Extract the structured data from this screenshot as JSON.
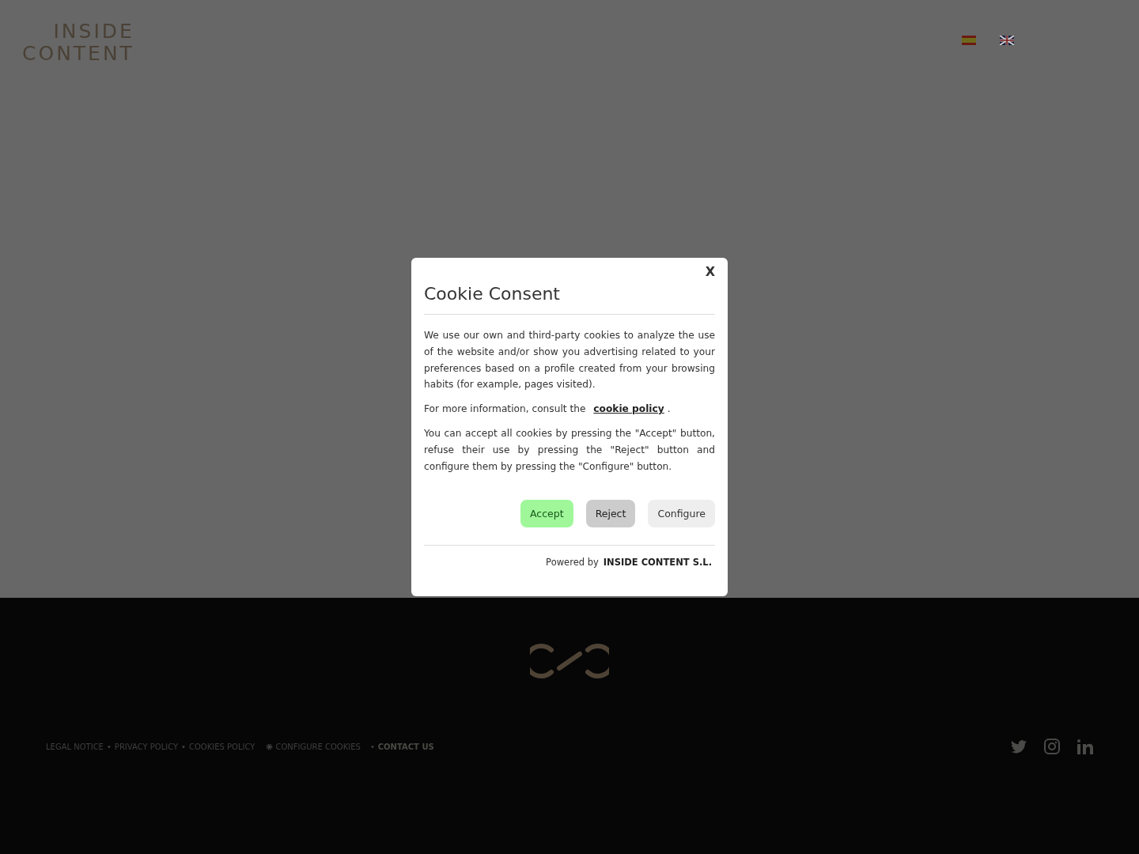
{
  "header": {
    "logo": {
      "line_1": "INSIDE",
      "line_2": "CONTENT"
    },
    "languages": [
      {
        "kind": "spain"
      },
      {
        "kind": "uk"
      }
    ]
  },
  "dialog": {
    "close": "X",
    "title": "Cookie Consent",
    "paragraphs": [
      {
        "kind": "text",
        "text": "We use our own and third-party cookies to analyze the use of the website and/or show you advertising related to your preferences based on a profile created from your browsing habits (for example, pages visited)."
      },
      {
        "kind": "link",
        "text": "For more information, consult the",
        "link": "cookie policy",
        "after": "."
      },
      {
        "kind": "text",
        "text": "You can accept all cookies by pressing the \"Accept\" button, refuse their use by pressing the \"Reject\" button and configure them by pressing the \"Configure\" button."
      }
    ],
    "buttons": [
      {
        "label": "Accept",
        "kind": "accept"
      },
      {
        "label": "Reject",
        "kind": "reject"
      },
      {
        "label": "Configure",
        "kind": "configure"
      }
    ],
    "powered_by": "Powered by",
    "company": "INSIDE CONTENT S.L."
  },
  "footer": {
    "links": [
      {
        "kind": "link",
        "text": "LEGAL NOTICE"
      },
      {
        "kind": "separator",
        "text": "•"
      },
      {
        "kind": "link",
        "text": "PRIVACY POLICY"
      },
      {
        "kind": "separator",
        "text": "•"
      },
      {
        "kind": "link",
        "text": "COOKIES POLICY"
      },
      {
        "kind": "gear",
        "text": "CONFIGURE COOKIES"
      },
      {
        "kind": "separator",
        "text": "•"
      },
      {
        "kind": "bold",
        "text": "CONTACT US"
      }
    ],
    "social": [
      {
        "kind": "twitter"
      },
      {
        "kind": "instagram"
      },
      {
        "kind": "linkedin"
      }
    ]
  }
}
